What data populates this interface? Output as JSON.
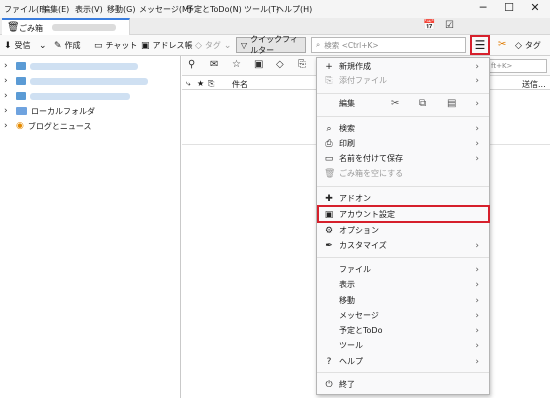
{
  "menubar": {
    "items": [
      "ファイル(F)",
      "編集(E)",
      "表示(V)",
      "移動(G)",
      "メッセージ(M)",
      "予定とToDo(N)",
      "ツール(T)",
      "ヘルプ(H)"
    ],
    "minimize": "─",
    "maximize": "☐",
    "close": "✕"
  },
  "tab": {
    "label": "ごみ箱"
  },
  "toolbar": {
    "get_mail": "受信",
    "write": "作成",
    "chat": "チャット",
    "address_book": "アドレス帳",
    "tag": "タグ",
    "quick_filter": "クイックフィルター",
    "search_placeholder": "検索 <Ctrl+K>",
    "tag_right": "タグ"
  },
  "folders": {
    "local": "ローカルフォルダ",
    "feeds": "ブログとニュース"
  },
  "message_list": {
    "filter_placeholder": "ft+K>",
    "subject_header": "件名",
    "sender_header": "送信..."
  },
  "app_menu": {
    "new": "新規作成",
    "attachment": "添付ファイル",
    "edit": "編集",
    "find": "検索",
    "print": "印刷",
    "save_as": "名前を付けて保存",
    "empty_trash": "ごみ箱を空にする",
    "addons": "アドオン",
    "account_settings": "アカウント設定",
    "options": "オプション",
    "customize": "カスタマイズ",
    "file": "ファイル",
    "view": "表示",
    "go": "移動",
    "message": "メッセージ",
    "events_tasks": "予定とToDo",
    "tools": "ツール",
    "help": "ヘルプ",
    "quit": "終了"
  },
  "colors": {
    "highlight": "#d6202c",
    "accent": "#3b7ddd"
  }
}
